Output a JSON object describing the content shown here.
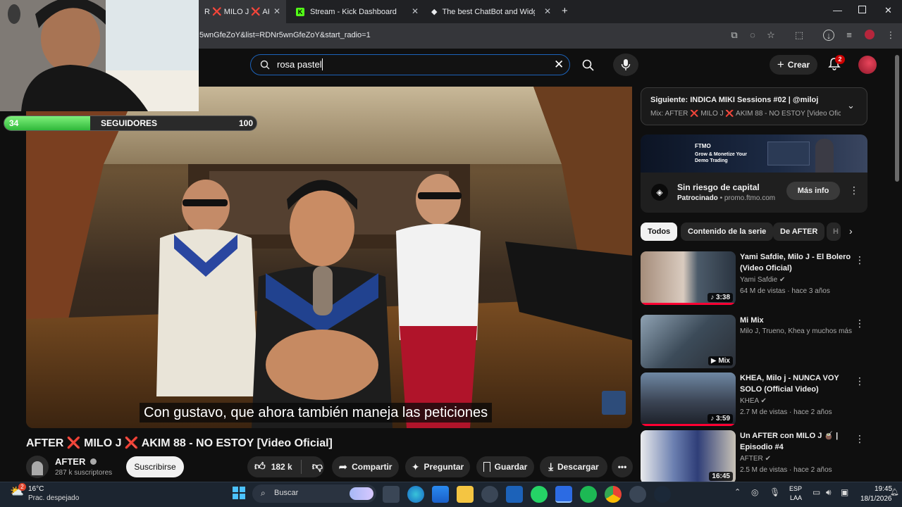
{
  "browser": {
    "tabs": [
      {
        "label": "R ❌ MILO J ❌ AKIM"
      },
      {
        "label": "Stream - Kick Dashboard"
      },
      {
        "label": "The best ChatBot and Widgets"
      }
    ],
    "new_tab_icon": "plus-icon",
    "url": "5wnGfeZoY&list=RDNr5wnGfeZoY&start_radio=1"
  },
  "overlay": {
    "followers_current": "34",
    "followers_label": "SEGUIDORES",
    "followers_goal": "100",
    "followers_progress": 0.34
  },
  "header": {
    "search_value": "rosa pastel",
    "create_label": "Crear",
    "notifications_count": "2"
  },
  "video": {
    "caption": "Con gustavo, que ahora también maneja las peticiones",
    "title": "AFTER ❌ MILO J ❌ AKIM 88 - NO ESTOY [Video Oficial]",
    "channel": "AFTER",
    "subscribers": "287 k suscriptores",
    "subscribe_label": "Suscribirse",
    "likes": "182 k",
    "share_label": "Compartir",
    "ask_label": "Preguntar",
    "save_label": "Guardar",
    "download_label": "Descargar"
  },
  "sidebar": {
    "next_title": "Siguiente: INDICA MIKI Sessions #02 | @miloj",
    "next_sub": "Mix: AFTER ❌ MILO J ❌ AKIM 88 - NO ESTOY [Video Ofici...",
    "ad": {
      "brand": "FTMO",
      "banner_text": "Grow & Monetize Your Demo Trading",
      "title": "Sin riesgo de capital",
      "sponsored": "Patrocinado",
      "domain": "promo.ftmo.com",
      "more_info": "Más info"
    },
    "chips": [
      "Todos",
      "Contenido de la serie",
      "De AFTER",
      "H"
    ],
    "videos": [
      {
        "title": "Yami Safdie, Milo J - El Bolero (Video Oficial)",
        "channel": "Yami Safdie",
        "meta": "64 M de vistas · hace 3 años",
        "duration": "3:38"
      },
      {
        "title": "Mi Mix",
        "channel": "Milo J, Trueno, Khea y muchos más",
        "meta": "",
        "duration": "Mix"
      },
      {
        "title": "KHEA, Milo j - NUNCA VOY SOLO (Official Video)",
        "channel": "KHEA",
        "meta": "2.7 M de vistas · hace 2 años",
        "duration": "3:59"
      },
      {
        "title": "Un AFTER con MILO J 🧉 | Episodio #4",
        "channel": "AFTER",
        "meta": "2.5 M de vistas · hace 2 años",
        "duration": "16:45"
      }
    ]
  },
  "taskbar": {
    "temperature": "16°C",
    "weather": "Prac. despejado",
    "weather_badge": "2",
    "search_label": "Buscar",
    "lang": "ESP",
    "region": "LAA",
    "time": "19:45",
    "date": "18/1/2026"
  },
  "colors": {
    "accent_red": "#ff0033",
    "progress_green": "#2fb83a",
    "search_border": "#1c62b9"
  }
}
